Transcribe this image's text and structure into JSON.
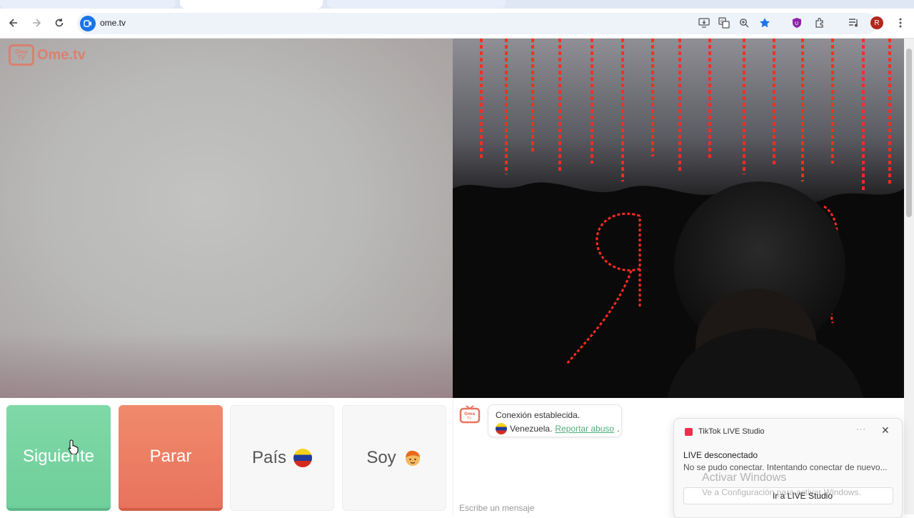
{
  "browser": {
    "url": "ome.tv",
    "profile_initial": "R",
    "icons": [
      "back-icon",
      "forward-icon",
      "reload-icon",
      "install-app-icon",
      "translate-icon",
      "zoom-icon",
      "bookmark-star-icon",
      "extension-shield-icon",
      "extensions-icon",
      "media-icon",
      "menu-icon"
    ]
  },
  "logo": {
    "text": "Ome.tv",
    "badge": "Ome TV"
  },
  "controls": {
    "next": "Siguiente",
    "stop": "Parar",
    "country": "País",
    "me": "Soy"
  },
  "chat": {
    "status": "Conexión establecida.",
    "country": "Venezuela.",
    "report": "Reportar abuso",
    "report_suffix": ".",
    "placeholder": "Escribe un mensaje"
  },
  "toast": {
    "app": "TikTok LIVE Studio",
    "title": "LIVE desconectado",
    "body": "No se pudo conectar. Intentando conectar de nuevo...",
    "action": "Ir a LIVE Studio",
    "more": "···",
    "close": "✕"
  },
  "watermark": {
    "line1": "Activar Windows",
    "line2": "Ve a Configuración para activar Windows."
  },
  "colors": {
    "next_green": "#7fd8a8",
    "stop_red": "#e8735c",
    "brand": "#e8735c",
    "link": "#4fae7c"
  }
}
